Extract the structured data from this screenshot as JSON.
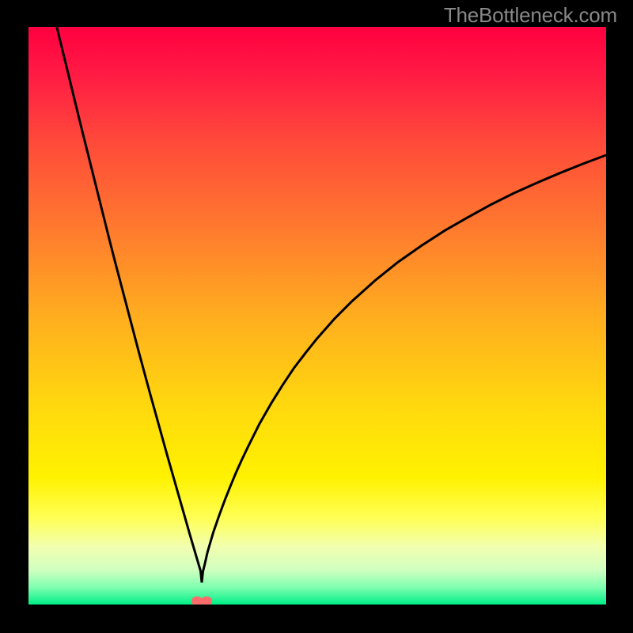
{
  "watermark": "TheBottleneck.com",
  "colors": {
    "black": "#000000",
    "curve": "#000000",
    "marker": "#ff6b6b",
    "gradient_stops": [
      {
        "offset": 0.0,
        "color": "#ff0040"
      },
      {
        "offset": 0.08,
        "color": "#ff1a44"
      },
      {
        "offset": 0.2,
        "color": "#ff4a3a"
      },
      {
        "offset": 0.35,
        "color": "#ff7a2e"
      },
      {
        "offset": 0.5,
        "color": "#ffad1f"
      },
      {
        "offset": 0.65,
        "color": "#ffd70f"
      },
      {
        "offset": 0.78,
        "color": "#fff200"
      },
      {
        "offset": 0.85,
        "color": "#ffff55"
      },
      {
        "offset": 0.9,
        "color": "#f2ffb0"
      },
      {
        "offset": 0.94,
        "color": "#d0ffc0"
      },
      {
        "offset": 0.97,
        "color": "#80ffb0"
      },
      {
        "offset": 1.0,
        "color": "#00ee88"
      }
    ]
  },
  "chart_data": {
    "type": "line",
    "title": "",
    "xlabel": "",
    "ylabel": "",
    "xlim": [
      0,
      100
    ],
    "ylim": [
      0,
      100
    ],
    "x": [
      4.9,
      6,
      7,
      8,
      9,
      10,
      11,
      12,
      13,
      14,
      15,
      16,
      17,
      18,
      19,
      20,
      21,
      22,
      23,
      24,
      25,
      26,
      27,
      28,
      29,
      29.5,
      29.8,
      30,
      30.2,
      30.5,
      31,
      32,
      33,
      34,
      35,
      36,
      37,
      38,
      40,
      42,
      44,
      46,
      48,
      50,
      53,
      56,
      60,
      64,
      68,
      72,
      76,
      80,
      84,
      88,
      92,
      96,
      100
    ],
    "y": [
      100,
      95.5,
      91.4,
      87.3,
      83.2,
      79.2,
      75.2,
      71.2,
      67.2,
      63.2,
      59.3,
      55.5,
      51.7,
      47.9,
      44.1,
      40.4,
      36.7,
      33.1,
      29.5,
      25.9,
      22.4,
      18.9,
      15.4,
      11.9,
      8.5,
      6.8,
      5.8,
      3.8,
      5.7,
      6.9,
      9.1,
      12.5,
      15.4,
      18.1,
      20.6,
      23.0,
      25.2,
      27.3,
      31.3,
      34.8,
      38.0,
      41.0,
      43.6,
      46.1,
      49.5,
      52.5,
      56.1,
      59.3,
      62.1,
      64.7,
      67.0,
      69.2,
      71.2,
      73.0,
      74.7,
      76.3,
      77.8
    ],
    "marker": {
      "x": 30,
      "y": 0.6
    },
    "annotations": []
  }
}
